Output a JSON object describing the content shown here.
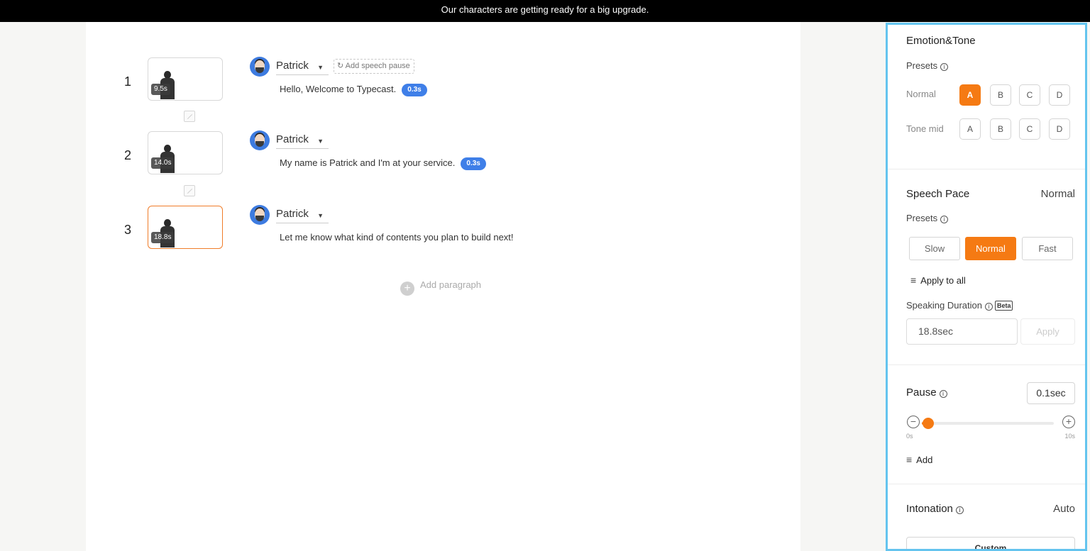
{
  "banner": {
    "text": "Our characters are getting ready for a big upgrade."
  },
  "paragraphs": [
    {
      "number": "1",
      "duration": "9.5s",
      "speaker": "Patrick",
      "add_pause_label": "Add speech pause",
      "text": "Hello, Welcome to Typecast.",
      "pause_pill": "0.3s"
    },
    {
      "number": "2",
      "duration": "14.0s",
      "speaker": "Patrick",
      "text": "My name is Patrick and I'm at your service.",
      "pause_pill": "0.3s"
    },
    {
      "number": "3",
      "duration": "18.8s",
      "speaker": "Patrick",
      "text": "Let me know what kind of contents you plan to build next!"
    }
  ],
  "add_paragraph_label": "Add paragraph",
  "panel": {
    "emotion": {
      "title": "Emotion&Tone",
      "presets_label": "Presets",
      "rows": [
        {
          "label": "Normal",
          "options": [
            "A",
            "B",
            "C",
            "D"
          ],
          "selected": "A"
        },
        {
          "label": "Tone mid",
          "options": [
            "A",
            "B",
            "C",
            "D"
          ],
          "selected": null
        }
      ]
    },
    "pace": {
      "title": "Speech Pace",
      "value": "Normal",
      "presets_label": "Presets",
      "options": [
        "Slow",
        "Normal",
        "Fast"
      ],
      "selected": "Normal",
      "apply_all_label": "Apply to all",
      "duration_label": "Speaking Duration",
      "beta_label": "Beta",
      "duration_value": "18.8sec",
      "apply_label": "Apply"
    },
    "pause": {
      "title": "Pause",
      "value": "0.1sec",
      "slider_fraction": 0.01,
      "min_label": "0s",
      "max_label": "10s",
      "add_label": "Add"
    },
    "intonation": {
      "title": "Intonation",
      "value": "Auto",
      "custom_label": "Custom"
    }
  },
  "colors": {
    "accent": "#f57a13",
    "pill_blue": "#3f7fe8",
    "panel_border": "#64c4ee"
  }
}
